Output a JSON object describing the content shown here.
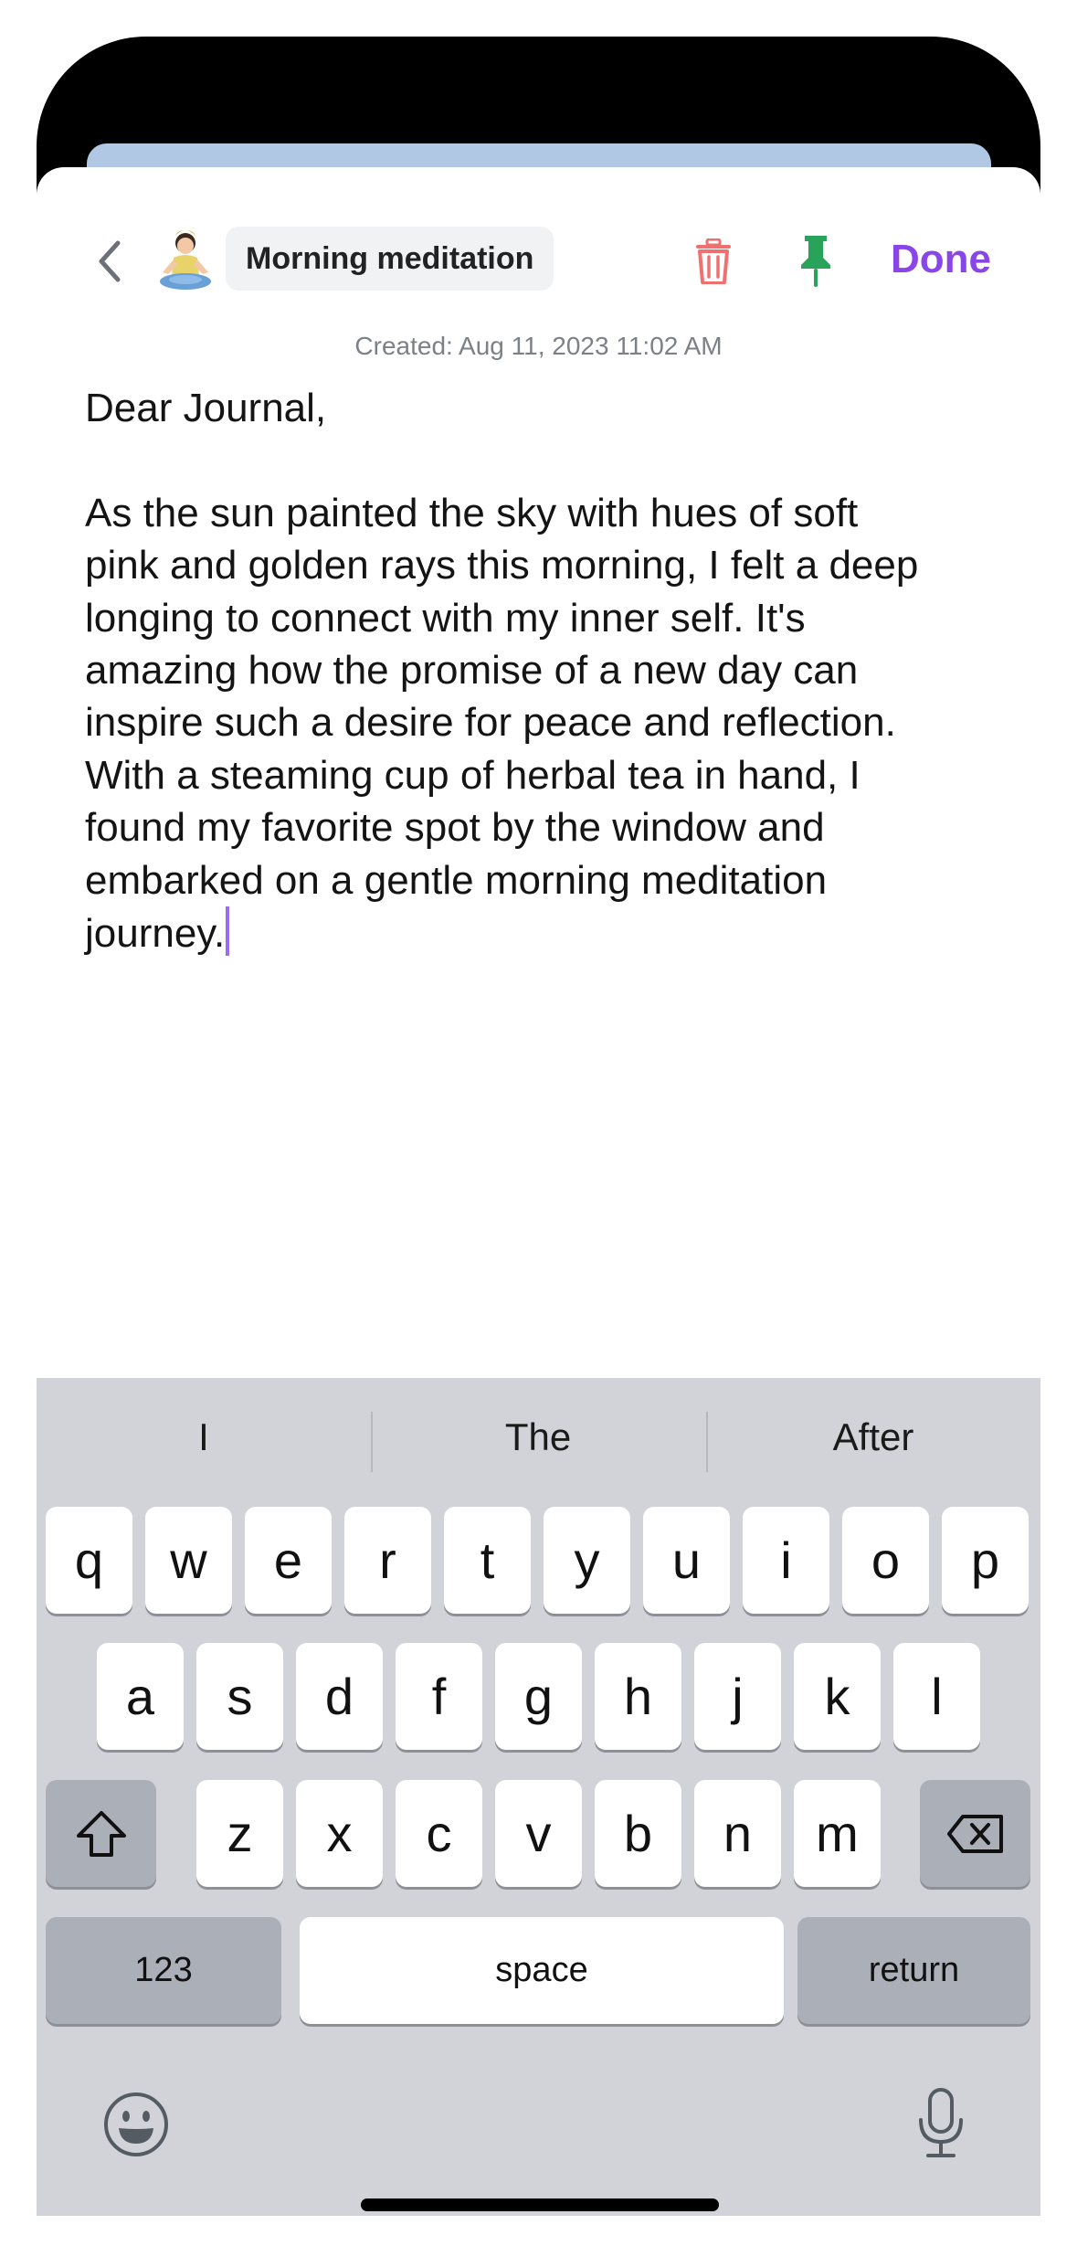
{
  "header": {
    "back_icon": "chevron-left-icon",
    "avatar_icon": "meditating-person-avatar",
    "title": "Morning meditation",
    "trash_icon": "trash-icon",
    "pin_icon": "pin-icon",
    "done_label": "Done",
    "colors": {
      "trash": "#f07070",
      "pin": "#2aa35a",
      "done": "#8a45e8"
    }
  },
  "entry": {
    "created": "Created: Aug 11, 2023 11:02 AM",
    "greeting": "Dear Journal,",
    "body": "As the sun painted the sky with hues of soft\npink and golden rays this morning, I felt a deep\nlonging to connect with my inner self. It's\namazing how the promise of a new day can\ninspire such a desire for peace and reflection.\nWith a steaming cup of herbal tea in hand, I\nfound my favorite spot by the window and\nembarked on a gentle morning meditation\njourney."
  },
  "keyboard": {
    "suggestions": [
      "I",
      "The",
      "After"
    ],
    "row1": [
      "q",
      "w",
      "e",
      "r",
      "t",
      "y",
      "u",
      "i",
      "o",
      "p"
    ],
    "row2": [
      "a",
      "s",
      "d",
      "f",
      "g",
      "h",
      "j",
      "k",
      "l"
    ],
    "row3": [
      "z",
      "x",
      "c",
      "v",
      "b",
      "n",
      "m"
    ],
    "numbers_label": "123",
    "space_label": "space",
    "return_label": "return",
    "shift_icon": "shift-icon",
    "backspace_icon": "backspace-icon",
    "emoji_icon": "emoji-icon",
    "mic_icon": "microphone-icon"
  }
}
